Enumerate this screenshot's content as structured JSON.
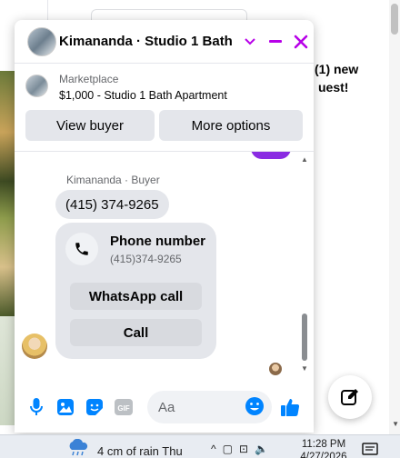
{
  "background": {
    "notification_lines": [
      "(1) new",
      "uest!"
    ]
  },
  "chat": {
    "title": "Kimananda · Studio 1 Bath ...",
    "listing": {
      "category": "Marketplace",
      "title": "$1,000 - Studio 1 Bath Apartment"
    },
    "buttons": {
      "view_buyer": "View buyer",
      "more_options": "More options"
    },
    "messages": {
      "sender": "Kimananda · Buyer",
      "phone_bubble": "(415) 374-9265",
      "card": {
        "title": "Phone number",
        "number": "(415)374-9265",
        "whatsapp": "WhatsApp call",
        "call": "Call"
      }
    },
    "composer": {
      "placeholder": "Aa"
    },
    "colors": {
      "accent": "#8a2be2",
      "icon_blue": "#0084ff",
      "header_icons": "#b700e8"
    }
  },
  "taskbar": {
    "weather": "4 cm of rain Thu",
    "time": "11:28 PM",
    "date": "4/27/2026"
  }
}
